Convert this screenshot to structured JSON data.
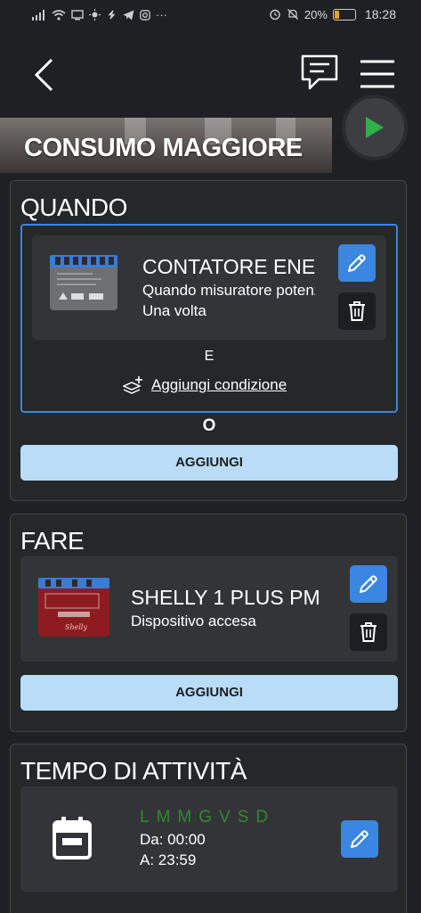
{
  "status_bar": {
    "time": "18:28",
    "battery": "20%",
    "left_icons": [
      "signal-icon",
      "wifi-icon",
      "monitor-icon",
      "sun-icon",
      "shazam-icon",
      "telegram-icon",
      "instagram-icon",
      "more-icon"
    ],
    "more": "···",
    "right_icons": [
      "alarm-icon",
      "mute-icon",
      "battery-icon"
    ],
    "battery_level": 0.2
  },
  "header": {
    "back_icon": "back-arrow-icon",
    "chat_icon": "chat-icon",
    "menu_icon": "hamburger-menu-icon"
  },
  "banner": {
    "title": "CONSUMO MAGGIORE",
    "play_icon": "play-icon"
  },
  "when": {
    "title": "QUANDO",
    "condition": {
      "title": "CONTATORE ENERGIA",
      "line1": "Quando misuratore potenza",
      "line2": "Una volta"
    },
    "and_label": "E",
    "add_condition_label": "Aggiungi condizione",
    "or_label": "O",
    "add_label": "AGGIUNGI"
  },
  "do": {
    "title": "FARE",
    "action": {
      "title": "SHELLY 1 PLUS PM",
      "line1": "Dispositivo accesa"
    },
    "add_label": "AGGIUNGI"
  },
  "activity": {
    "title": "TEMPO DI ATTIVITÀ",
    "days": [
      "L",
      "M",
      "M",
      "G",
      "V",
      "S",
      "D"
    ],
    "from": "Da: 00:00",
    "to": "A: 23:59"
  },
  "colors": {
    "background": "#1f2023",
    "panel": "#262729",
    "card": "#333438",
    "accent_blue": "#3a86e0",
    "selected_border": "#3a86e0",
    "add_button": "#b9dcf7",
    "days_green": "#2e8b2e",
    "play_green": "#2fb04a"
  }
}
